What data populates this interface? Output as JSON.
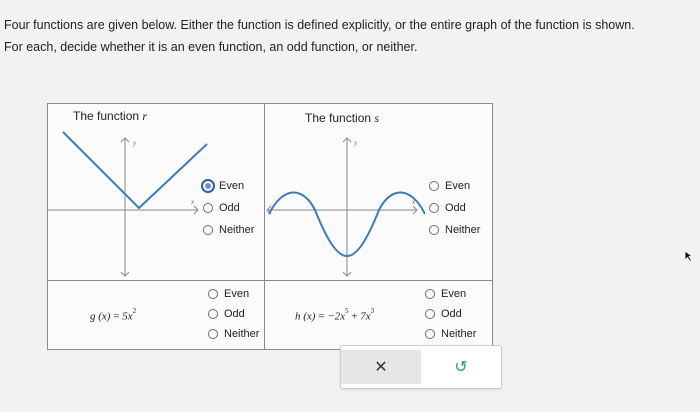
{
  "instructions": {
    "line1": "Four functions are given below. Either the function is defined explicitly, or the entire graph of the function is shown.",
    "line2": "For each, decide whether it is an even function, an odd function, or neither."
  },
  "functions": [
    {
      "title_prefix": "The function",
      "name": "r",
      "choices": [
        "Even",
        "Odd",
        "Neither"
      ],
      "selected": "Even"
    },
    {
      "title_prefix": "The function",
      "name": "s",
      "choices": [
        "Even",
        "Odd",
        "Neither"
      ],
      "selected": null
    },
    {
      "formula_lhs": "g (x)",
      "formula_eq": "=",
      "formula_rhs": "5x",
      "formula_exp": "2",
      "choices": [
        "Even",
        "Odd",
        "Neither"
      ],
      "selected": null
    },
    {
      "formula_lhs": "h (x)",
      "formula_eq": "=",
      "formula_t1": "−2x",
      "formula_e1": "5",
      "formula_op": "+",
      "formula_t2": "7x",
      "formula_e2": "3",
      "choices": [
        "Even",
        "Odd",
        "Neither"
      ],
      "selected": null
    }
  ],
  "axes": {
    "x_label": "x",
    "y_label": "y"
  },
  "buttons": {
    "clear": "✕",
    "undo": "↺"
  },
  "colors": {
    "curve": "#3d7ab8",
    "axis": "#8a8a8a",
    "selected_radio": "#2f5fa7",
    "undo": "#2d9a8c"
  }
}
